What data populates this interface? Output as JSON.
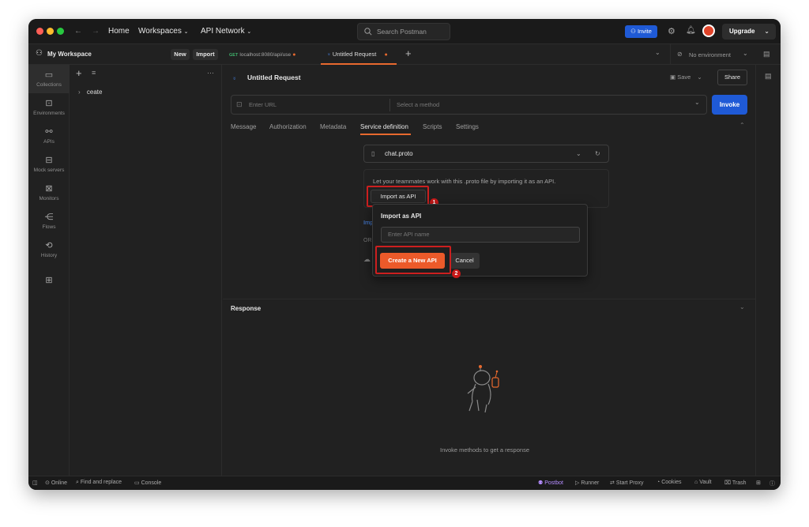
{
  "titlebar": {
    "home": "Home",
    "workspaces": "Workspaces",
    "api_network": "API Network",
    "search_placeholder": "Search Postman",
    "invite": "Invite",
    "upgrade": "Upgrade"
  },
  "workspace": {
    "name": "My Workspace",
    "new_label": "New",
    "import_label": "Import"
  },
  "tabs": [
    {
      "method": "GET",
      "label": "localhost:8080/api/use"
    },
    {
      "label": "Untitled Request"
    }
  ],
  "environment": "No environment",
  "left_rail": [
    "Collections",
    "Environments",
    "APIs",
    "Mock servers",
    "Monitors",
    "Flows",
    "History"
  ],
  "sidebar": {
    "tree_item": "ceate"
  },
  "request": {
    "title": "Untitled Request",
    "save_label": "Save",
    "share_label": "Share",
    "url_placeholder": "Enter URL",
    "method_placeholder": "Select a method",
    "invoke_label": "Invoke"
  },
  "subtabs": [
    "Message",
    "Authorization",
    "Metadata",
    "Service definition",
    "Scripts",
    "Settings"
  ],
  "active_subtab": "Service definition",
  "service_def": {
    "proto_file": "chat.proto",
    "info_text": "Let your teammates work with this .proto file by importing it as an API.",
    "import_button": "Import as API",
    "partial_link": "Imp",
    "or_text": "OR"
  },
  "popover": {
    "title": "Import as API",
    "name_placeholder": "Enter API name",
    "create_button": "Create a New API",
    "cancel_button": "Cancel"
  },
  "annotations": {
    "badge1": "1",
    "badge2": "2"
  },
  "response": {
    "title": "Response",
    "empty_text": "Invoke methods to get a response"
  },
  "statusbar": {
    "online": "Online",
    "find_replace": "Find and replace",
    "console": "Console",
    "postbot": "Postbot",
    "runner": "Runner",
    "start_proxy": "Start Proxy",
    "cookies": "Cookies",
    "vault": "Vault",
    "trash": "Trash"
  },
  "colors": {
    "accent_blue": "#1f5ad6",
    "accent_orange": "#ec5a2a",
    "annotation_red": "#cc1f1f"
  }
}
